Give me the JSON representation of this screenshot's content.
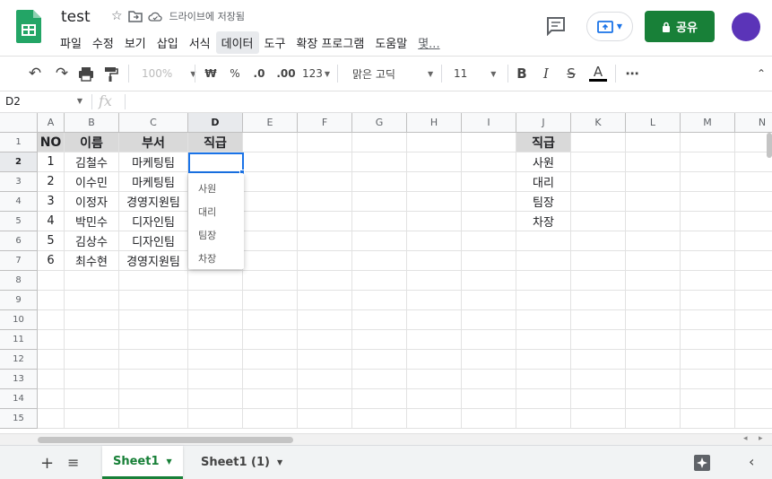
{
  "header": {
    "doc_title": "test",
    "save_status": "드라이브에 저장됨",
    "share_label": "공유",
    "menu": [
      "파일",
      "수정",
      "보기",
      "삽입",
      "서식",
      "데이터",
      "도구",
      "확장 프로그램",
      "도움말",
      "몇..."
    ]
  },
  "toolbar": {
    "zoom": "100%",
    "currency": "₩",
    "percent": "%",
    "dec_less": ".0",
    "dec_more": ".00",
    "format_more": "123",
    "font": "맑은 고딕",
    "font_size": "11",
    "bold": "B",
    "italic": "I",
    "strike": "S",
    "text_color": "A",
    "more": "⋯"
  },
  "formula_bar": {
    "name_box": "D2",
    "fx": "fx"
  },
  "grid": {
    "columns": [
      "A",
      "B",
      "C",
      "D",
      "E",
      "F",
      "G",
      "H",
      "I",
      "J",
      "K",
      "L",
      "M",
      "N"
    ],
    "rows": [
      "1",
      "2",
      "3",
      "4",
      "5",
      "6",
      "7",
      "8",
      "9",
      "10",
      "11",
      "12",
      "13",
      "14",
      "15"
    ],
    "table_header": [
      "NO",
      "이름",
      "부서",
      "직급"
    ],
    "table_rows": [
      [
        "1",
        "김철수",
        "마케팅팀",
        ""
      ],
      [
        "2",
        "이수민",
        "마케팅팀",
        ""
      ],
      [
        "3",
        "이정자",
        "경영지원팀",
        ""
      ],
      [
        "4",
        "박민수",
        "디자인팀",
        ""
      ],
      [
        "5",
        "김상수",
        "디자인팀",
        ""
      ],
      [
        "6",
        "최수현",
        "경영지원팀",
        ""
      ]
    ],
    "list_header": "직급",
    "list_values": [
      "사원",
      "대리",
      "팀장",
      "차장"
    ],
    "selected_cell": "D2"
  },
  "dropdown": {
    "options": [
      "사원",
      "대리",
      "팀장",
      "차장"
    ]
  },
  "sheets": {
    "tabs": [
      "Sheet1",
      "Sheet1 (1)"
    ],
    "active": "Sheet1"
  },
  "colors": {
    "brand_green": "#188038",
    "selection_blue": "#1a73e8",
    "header_fill": "#d9d9d9",
    "avatar": "#5b34b8"
  }
}
